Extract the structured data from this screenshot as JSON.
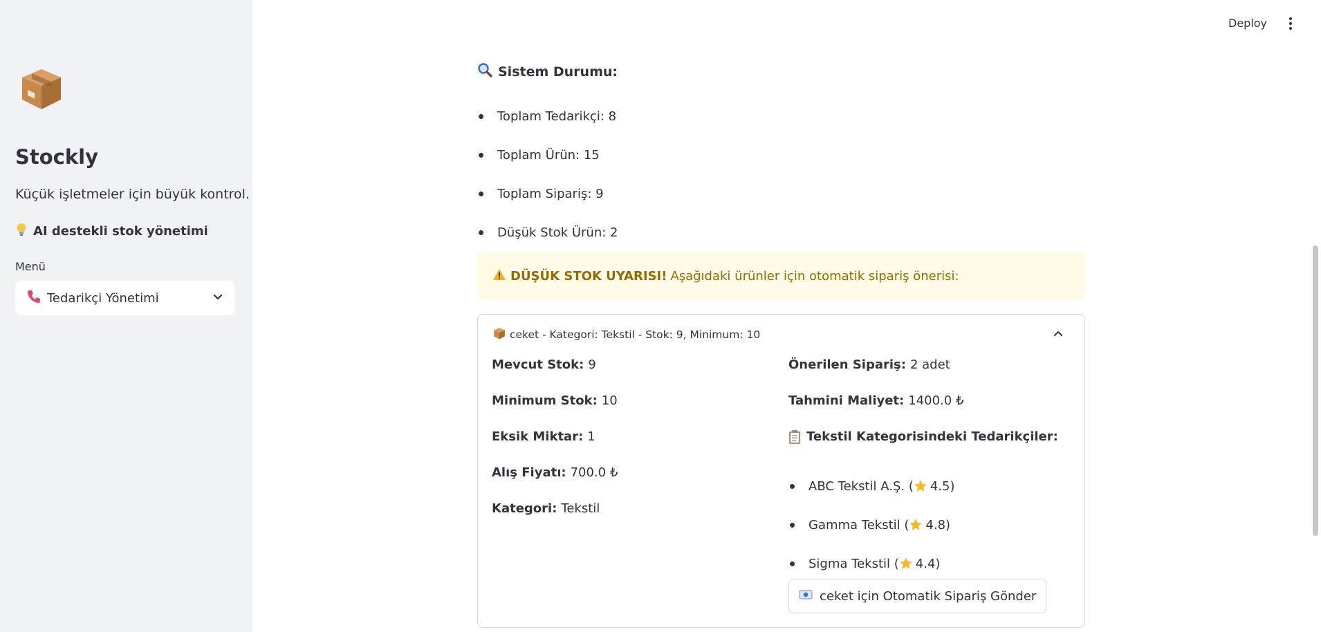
{
  "sidebar": {
    "logo_icon": "package-box-icon",
    "title": "Stockly",
    "tagline": "Küçük işletmeler için büyük kontrol.",
    "feature_icon": "lightbulb-icon",
    "feature": "AI destekli stok yönetimi",
    "menu_label": "Menü",
    "menu_selected_icon": "phone-icon",
    "menu_selected": "Tedarikçi Yönetimi"
  },
  "topbar": {
    "deploy_label": "Deploy",
    "menu_icon": "kebab-menu-icon"
  },
  "status": {
    "icon": "magnifier-icon",
    "heading": "Sistem Durumu:",
    "items": [
      {
        "label": "Toplam Tedarikçi: 8"
      },
      {
        "label": "Toplam Ürün: 15"
      },
      {
        "label": "Toplam Sipariş: 9"
      },
      {
        "label": "Düşük Stok Ürün: 2"
      }
    ]
  },
  "warning": {
    "icon": "warning-icon",
    "title": "DÜŞÜK STOK UYARISI!",
    "text": "Aşağıdaki ürünler için otomatik sipariş önerisi:",
    "color": "#926c05",
    "background": "#fffbe6"
  },
  "expander": {
    "header_icon": "package-box-icon",
    "header": "ceket - Kategori: Tekstil - Stok: 9, Minimum: 10",
    "expanded": true,
    "left_fields": [
      {
        "label": "Mevcut Stok:",
        "value": "9"
      },
      {
        "label": "Minimum Stok:",
        "value": "10"
      },
      {
        "label": "Eksik Miktar:",
        "value": "1"
      },
      {
        "label": "Alış Fiyatı:",
        "value": "700.0 ₺"
      },
      {
        "label": "Kategori:",
        "value": "Tekstil"
      }
    ],
    "right_fields": [
      {
        "label": "Önerilen Sipariş:",
        "value": "2 adet"
      },
      {
        "label": "Tahmini Maliyet:",
        "value": "1400.0 ₺"
      }
    ],
    "suppliers_icon": "clipboard-icon",
    "suppliers_heading": "Tekstil Kategorisindeki Tedarikçiler:",
    "suppliers": [
      {
        "name": "ABC Tekstil A.Ş. (",
        "rating": "4.5)"
      },
      {
        "name": "Gamma Tekstil (",
        "rating": "4.8)"
      },
      {
        "name": "Sigma Tekstil (",
        "rating": "4.4)"
      }
    ],
    "order_button_icon": "mailbox-icon",
    "order_button": "ceket için Otomatik Sipariş Gönder"
  }
}
